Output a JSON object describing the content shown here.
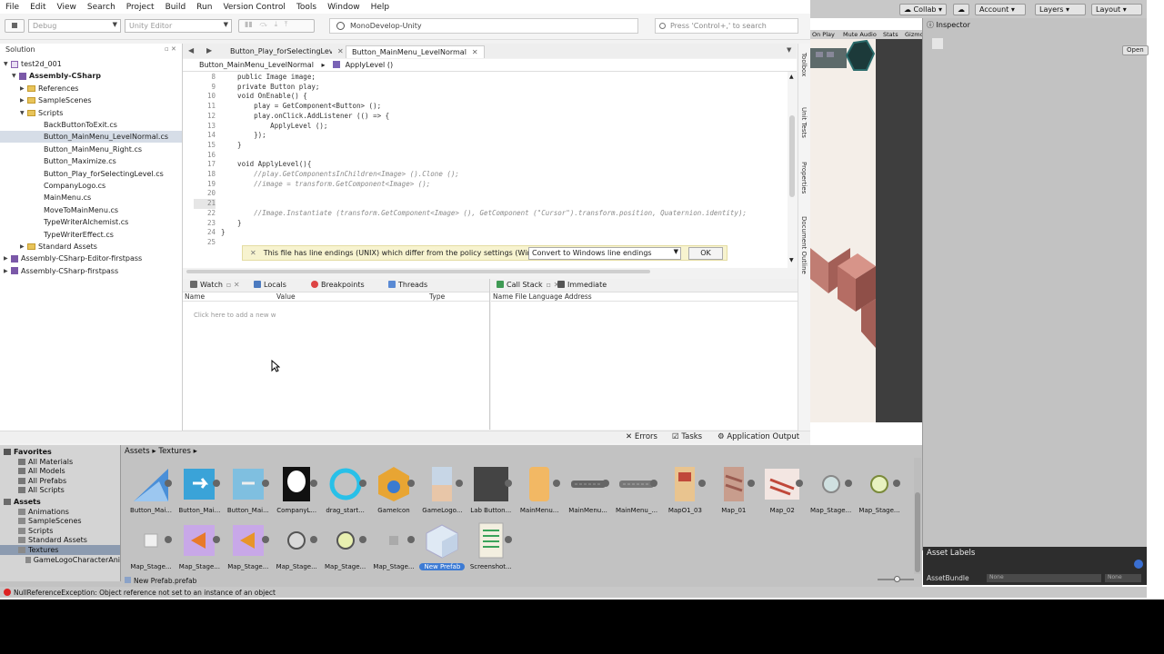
{
  "menu": [
    "File",
    "Edit",
    "View",
    "Search",
    "Project",
    "Build",
    "Run",
    "Version Control",
    "Tools",
    "Window",
    "Help"
  ],
  "toolbar": {
    "config": "Debug",
    "target": "Unity Editor",
    "status": "MonoDevelop-Unity",
    "search_placeholder": "Press 'Control+,' to search"
  },
  "solution": {
    "title": "Solution",
    "items": [
      {
        "label": "test2d_001",
        "indent": 0,
        "kind": "sln",
        "expanded": true
      },
      {
        "label": "Assembly-CSharp",
        "indent": 1,
        "kind": "proj",
        "expanded": true,
        "bold": true
      },
      {
        "label": "References",
        "indent": 2,
        "kind": "folder",
        "expanded": false
      },
      {
        "label": "SampleScenes",
        "indent": 2,
        "kind": "folder",
        "expanded": false
      },
      {
        "label": "Scripts",
        "indent": 2,
        "kind": "folder",
        "expanded": true
      },
      {
        "label": "BackButtonToExit.cs",
        "indent": 3,
        "kind": "cs"
      },
      {
        "label": "Button_MainMenu_LevelNormal.cs",
        "indent": 3,
        "kind": "cs",
        "selected": true
      },
      {
        "label": "Button_MainMenu_Right.cs",
        "indent": 3,
        "kind": "cs"
      },
      {
        "label": "Button_Maximize.cs",
        "indent": 3,
        "kind": "cs"
      },
      {
        "label": "Button_Play_forSelectingLevel.cs",
        "indent": 3,
        "kind": "cs"
      },
      {
        "label": "CompanyLogo.cs",
        "indent": 3,
        "kind": "cs"
      },
      {
        "label": "MainMenu.cs",
        "indent": 3,
        "kind": "cs"
      },
      {
        "label": "MoveToMainMenu.cs",
        "indent": 3,
        "kind": "cs"
      },
      {
        "label": "TypeWriterAlchemist.cs",
        "indent": 3,
        "kind": "cs"
      },
      {
        "label": "TypeWriterEffect.cs",
        "indent": 3,
        "kind": "cs"
      },
      {
        "label": "Standard Assets",
        "indent": 2,
        "kind": "folder",
        "expanded": false
      },
      {
        "label": "Assembly-CSharp-Editor-firstpass",
        "indent": 0,
        "kind": "proj",
        "expanded": false
      },
      {
        "label": "Assembly-CSharp-firstpass",
        "indent": 0,
        "kind": "proj",
        "expanded": false
      }
    ]
  },
  "editor": {
    "tabs": [
      {
        "label": "Button_Play_forSelectingLevel.cs",
        "active": false
      },
      {
        "label": "Button_MainMenu_LevelNormal",
        "active": true
      }
    ],
    "breadcrumb_class": "Button_MainMenu_LevelNormal",
    "breadcrumb_method": "ApplyLevel ()",
    "lines": [
      {
        "n": "8",
        "text": "    public Image image;",
        "type": "code"
      },
      {
        "n": "9",
        "text": "    private Button play;",
        "type": "code"
      },
      {
        "n": "10",
        "text": "    void OnEnable() {",
        "type": "code"
      },
      {
        "n": "11",
        "text": "        play = GetComponent<Button> ();",
        "type": "code"
      },
      {
        "n": "12",
        "text": "        play.onClick.AddListener (() => {",
        "type": "code"
      },
      {
        "n": "13",
        "text": "            ApplyLevel ();",
        "type": "code"
      },
      {
        "n": "14",
        "text": "        });",
        "type": "code"
      },
      {
        "n": "15",
        "text": "    }",
        "type": "code"
      },
      {
        "n": "16",
        "text": "",
        "type": "code"
      },
      {
        "n": "17",
        "text": "    void ApplyLevel(){",
        "type": "code"
      },
      {
        "n": "18",
        "text": "        //play.GetComponentsInChildren<Image> ().Clone ();",
        "type": "comment"
      },
      {
        "n": "19",
        "text": "        //image = transform.GetComponent<Image> ();",
        "type": "comment"
      },
      {
        "n": "20",
        "text": "",
        "type": "code"
      },
      {
        "n": "21",
        "text": "",
        "type": "current"
      },
      {
        "n": "22",
        "text": "        //Image.Instantiate (transform.GetComponent<Image> (), GetComponent (\"Cursor\").transform.position, Quaternion.identity);",
        "type": "comment"
      },
      {
        "n": "23",
        "text": "    }",
        "type": "code"
      },
      {
        "n": "24",
        "text": "}",
        "type": "code"
      },
      {
        "n": "25",
        "text": "",
        "type": "code"
      }
    ],
    "infobar": {
      "message": "This file has line endings (UNIX) which differ from the policy settings (Windows).",
      "option": "Convert to Windows line endings",
      "ok": "OK"
    }
  },
  "sidepads": [
    "Toolbox",
    "Unit Tests",
    "Properties",
    "Document Outline"
  ],
  "watch": {
    "tabs": [
      "Watch",
      "Locals",
      "Breakpoints",
      "Threads"
    ],
    "columns": [
      "Name",
      "Value",
      "Type"
    ],
    "hint": "Click here to add a new w"
  },
  "callstack": {
    "tabs": [
      "Call Stack",
      "Immediate"
    ],
    "columns": "Name File Language Address"
  },
  "md_status": [
    "Errors",
    "Tasks",
    "Application Output"
  ],
  "unity": {
    "top_buttons": [
      "Collab",
      "Account",
      "Layers",
      "Layout"
    ],
    "scene_tabs": [
      "On Play",
      "Mute Audio",
      "Stats",
      "Gizmo"
    ],
    "inspector_title": "Inspector",
    "open_label": "Open",
    "asset_labels_title": "Asset Labels",
    "asset_bundle_label": "AssetBundle",
    "asset_bundle_value": "None",
    "asset_bundle_variant": "None"
  },
  "project": {
    "favorites_title": "Favorites",
    "favorites": [
      "All Materials",
      "All Models",
      "All Prefabs",
      "All Scripts"
    ],
    "assets_title": "Assets",
    "assets_tree": [
      "Animations",
      "SampleScenes",
      "Scripts",
      "Standard Assets",
      "Textures",
      "GameLogoCharacterAni"
    ],
    "crumb": "Assets ▸ Textures ▸",
    "row1": [
      "Button_Mai...",
      "Button_Mai...",
      "Button_Mai...",
      "CompanyL...",
      "drag_start...",
      "GameIcon",
      "GameLogo...",
      "Lab Button...",
      "MainMenu...",
      "MainMenu...",
      "MainMenu_...",
      "MapO1_03",
      "Map_01",
      "Map_02",
      "Map_Stage...",
      "Map_Stage..."
    ],
    "row2": [
      "Map_Stage...",
      "Map_Stage...",
      "Map_Stage...",
      "Map_Stage...",
      "Map_Stage...",
      "Map_Stage...",
      "New Prefab",
      "Screenshot..."
    ],
    "status": "New Prefab.prefab"
  },
  "console": "NullReferenceException: Object reference not set to an instance of an object"
}
